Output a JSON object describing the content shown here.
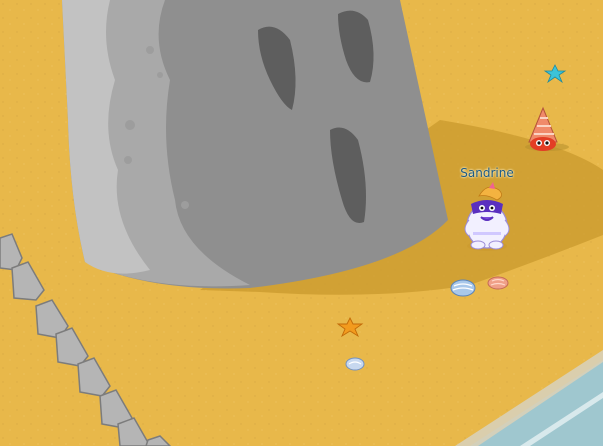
{
  "scene": {
    "type": "beach-game-room",
    "colors": {
      "sand": "#e8b84a",
      "sand_shade": "#c99a2e",
      "rock_dark": "#8f8f8f",
      "rock_mid": "#a8a8a8",
      "rock_light": "#c4c4c4",
      "water": "#9fc7cf",
      "avatar_body": "#f2f0ff",
      "avatar_mask": "#5a2fbf",
      "name_color": "#1b5a86"
    }
  },
  "player": {
    "name": "Sandrine",
    "icon": "yeti-avatar-icon"
  },
  "items": [
    {
      "name": "cyan-starfish-icon"
    },
    {
      "name": "orange-starfish-icon"
    },
    {
      "name": "blue-shell-icon"
    },
    {
      "name": "pink-shell-icon"
    },
    {
      "name": "small-blue-shell-icon"
    },
    {
      "name": "hermit-crab-icon"
    }
  ]
}
